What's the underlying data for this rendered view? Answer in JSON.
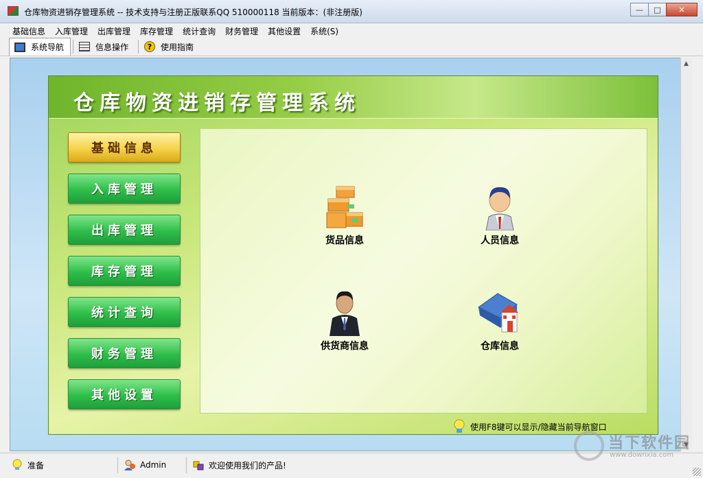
{
  "window": {
    "title": "仓库物资进销存管理系统 -- 技术支持与注册正版联系QQ 510000118   当前版本：(非注册版)",
    "buttons": {
      "minimize": "—",
      "maximize": "□",
      "close": "✕"
    }
  },
  "menubar": {
    "items": [
      "基础信息",
      "入库管理",
      "出库管理",
      "库存管理",
      "统计查询",
      "财务管理",
      "其他设置",
      "系统(S)"
    ]
  },
  "toolbar": {
    "tabs": [
      {
        "label": "系统导航",
        "icon": "monitor-icon",
        "active": true
      },
      {
        "label": "信息操作",
        "icon": "grid-icon",
        "active": false
      },
      {
        "label": "使用指南",
        "icon": "help-icon",
        "active": false
      }
    ]
  },
  "nav": {
    "title": "仓库物资进销存管理系统",
    "side_buttons": [
      {
        "label": "基础信息",
        "active": true
      },
      {
        "label": "入库管理",
        "active": false
      },
      {
        "label": "出库管理",
        "active": false
      },
      {
        "label": "库存管理",
        "active": false
      },
      {
        "label": "统计查询",
        "active": false
      },
      {
        "label": "财务管理",
        "active": false
      },
      {
        "label": "其他设置",
        "active": false
      }
    ],
    "features": [
      {
        "label": "货品信息",
        "icon": "boxes-icon"
      },
      {
        "label": "人员信息",
        "icon": "person-icon"
      },
      {
        "label": "供货商信息",
        "icon": "supplier-icon"
      },
      {
        "label": "仓库信息",
        "icon": "warehouse-icon"
      }
    ],
    "tip": "使用F8键可以显示/隐藏当前导航窗口"
  },
  "statusbar": {
    "status": "准备",
    "user": "Admin",
    "message": "欢迎使用我们的产品!"
  },
  "watermark": {
    "main": "当下软件园",
    "sub": "www.downxia.com"
  },
  "colors": {
    "nav_green": "#95cd45",
    "button_green": "#2fbe49",
    "button_active_gold": "#f5d24a",
    "client_blue": "#a9d0ef"
  }
}
